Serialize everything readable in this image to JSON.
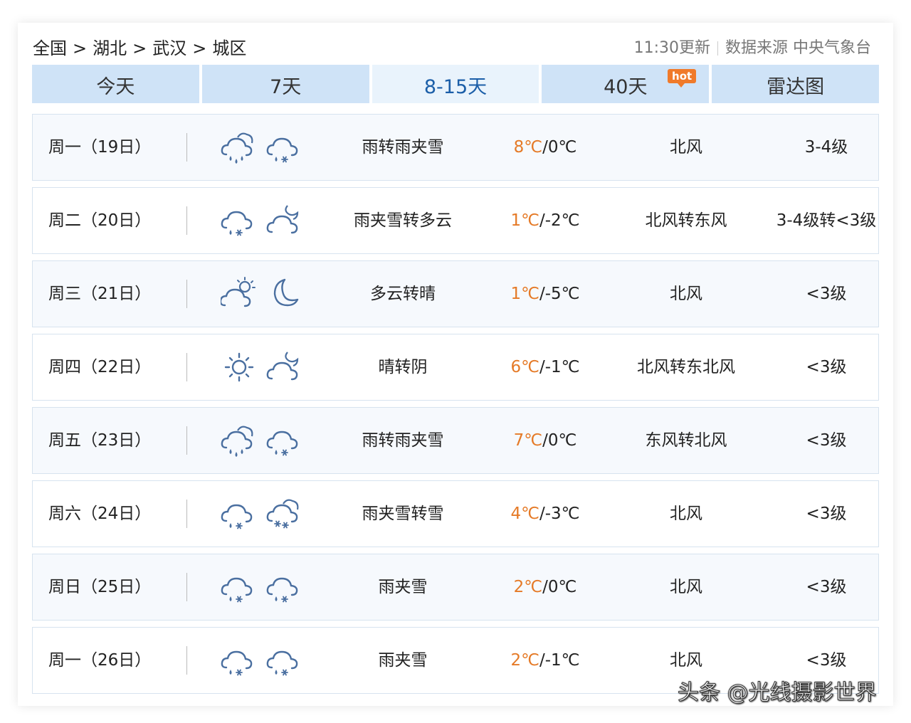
{
  "breadcrumb": [
    "全国",
    "湖北",
    "武汉",
    "城区"
  ],
  "breadcrumb_sep": ">",
  "source": {
    "update": "11:30更新",
    "label": "数据来源 中央气象台"
  },
  "tabs": [
    {
      "label": "今天"
    },
    {
      "label": "7天"
    },
    {
      "label": "8-15天",
      "active": true
    },
    {
      "label": "40天",
      "badge": "hot"
    },
    {
      "label": "雷达图"
    }
  ],
  "colors": {
    "tab_bg": "#cfe3f7",
    "tab_active_text": "#1b5ea8",
    "high_temp": "#e57a27",
    "badge": "#f07a2a",
    "icon": "#4a6fa0"
  },
  "rows": [
    {
      "day": "周一（19日）",
      "icon_day": "rain-cloud-icon",
      "icon_night": "sleet-icon",
      "desc": "雨转雨夹雪",
      "high": "8℃",
      "low": "/0℃",
      "wind": "北风",
      "level": "3-4级"
    },
    {
      "day": "周二（20日）",
      "icon_day": "sleet-icon",
      "icon_night": "cloudy-night-icon",
      "desc": "雨夹雪转多云",
      "high": "1℃",
      "low": "/-2℃",
      "wind": "北风转东风",
      "level": "3-4级转<3级"
    },
    {
      "day": "周三（21日）",
      "icon_day": "partly-cloudy-day-icon",
      "icon_night": "moon-icon",
      "desc": "多云转晴",
      "high": "1℃",
      "low": "/-5℃",
      "wind": "北风",
      "level": "<3级"
    },
    {
      "day": "周四（22日）",
      "icon_day": "sun-icon",
      "icon_night": "cloudy-night-icon",
      "desc": "晴转阴",
      "high": "6℃",
      "low": "/-1℃",
      "wind": "北风转东北风",
      "level": "<3级"
    },
    {
      "day": "周五（23日）",
      "icon_day": "rain-cloud-icon",
      "icon_night": "sleet-icon",
      "desc": "雨转雨夹雪",
      "high": "7℃",
      "low": "/0℃",
      "wind": "东风转北风",
      "level": "<3级"
    },
    {
      "day": "周六（24日）",
      "icon_day": "sleet-icon",
      "icon_night": "snow-cloud-icon",
      "desc": "雨夹雪转雪",
      "high": "4℃",
      "low": "/-3℃",
      "wind": "北风",
      "level": "<3级"
    },
    {
      "day": "周日（25日）",
      "icon_day": "sleet-icon",
      "icon_night": "sleet-icon",
      "desc": "雨夹雪",
      "high": "2℃",
      "low": "/0℃",
      "wind": "北风",
      "level": "<3级"
    },
    {
      "day": "周一（26日）",
      "icon_day": "sleet-icon",
      "icon_night": "sleet-icon",
      "desc": "雨夹雪",
      "high": "2℃",
      "low": "/-1℃",
      "wind": "北风",
      "level": "<3级"
    }
  ],
  "watermark": "头条 @光线摄影世界"
}
